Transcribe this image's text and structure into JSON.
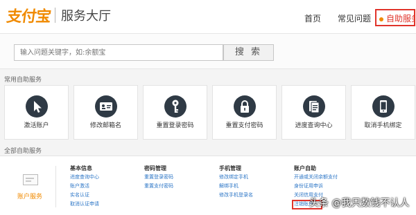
{
  "header": {
    "logo_text": "支付宝",
    "site_title": "服务大厅",
    "nav": {
      "home": "首页",
      "faq": "常见问题",
      "self_service": "自助服务"
    }
  },
  "search": {
    "placeholder": "输入问题关键字，如:余额宝",
    "button_label": "搜 索"
  },
  "common_services": {
    "label": "常用自助服务",
    "items": [
      {
        "label": "激活账户",
        "icon": "cursor-click-icon"
      },
      {
        "label": "修改邮箱名",
        "icon": "id-card-icon"
      },
      {
        "label": "重置登录密码",
        "icon": "key-icon"
      },
      {
        "label": "重置支付密码",
        "icon": "lock-icon"
      },
      {
        "label": "进度查询中心",
        "icon": "document-stack-icon"
      },
      {
        "label": "取消手机绑定",
        "icon": "mobile-phone-icon"
      }
    ]
  },
  "all_services": {
    "label": "全部自助服务",
    "category": "账户服务",
    "columns": [
      {
        "heading": "基本信息",
        "links": [
          "进度查询中心",
          "账户激活",
          "实名认证",
          "取消认证申请"
        ]
      },
      {
        "heading": "密码管理",
        "links": [
          "重置登录密码",
          "重置支付密码"
        ]
      },
      {
        "heading": "手机管理",
        "links": [
          "修改绑定手机",
          "解绑手机",
          "修改手机登录名"
        ]
      },
      {
        "heading": "账户自助",
        "links": [
          "开通或关闭余额支付",
          "身份证用申诉",
          "关闭信用支付",
          "注销账户"
        ]
      }
    ]
  },
  "watermark": "头条 @我只数钱不认人",
  "colors": {
    "brand_orange": "#f08a00",
    "highlight_red": "#e0332a",
    "link_blue": "#2b75c6",
    "icon_dark": "#2f3a45"
  }
}
